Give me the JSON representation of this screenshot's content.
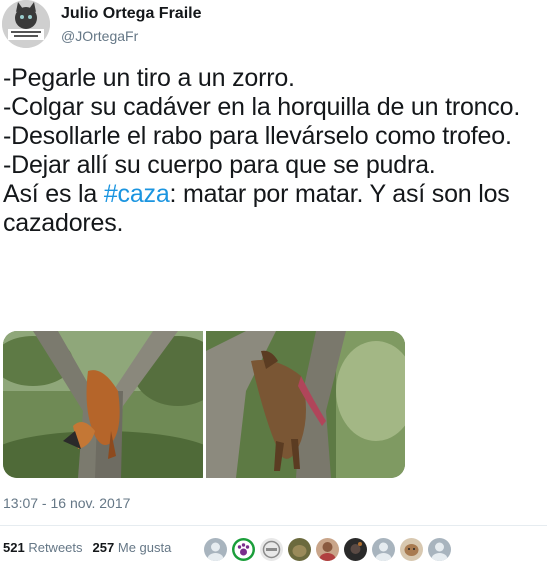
{
  "tweet": {
    "author": {
      "display_name": "Julio Ortega Fraile",
      "handle": "@JOrtegaFr"
    },
    "text": {
      "line_1": "-Pegarle un tiro a un zorro.",
      "line_2": "-Colgar su cadáver en la horquilla de un tronco.",
      "line_3": "-Desollarle el rabo para llevárselo como trofeo.",
      "line_4": "-Dejar allí su cuerpo para que se pudra.",
      "line_5_prefix": "Así es la ",
      "hashtag": "#caza",
      "line_5_suffix": ": matar por matar. Y así son los cazadores."
    },
    "timestamp": "13:07 - 16 nov. 2017",
    "stats": {
      "retweets_count": "521",
      "retweets_label": "Retweets",
      "likes_count": "257",
      "likes_label": "Me gusta"
    }
  },
  "colors": {
    "text": "#14171a",
    "secondary": "#657786",
    "link": "#1b95e0",
    "divider": "#e6ecf0"
  }
}
